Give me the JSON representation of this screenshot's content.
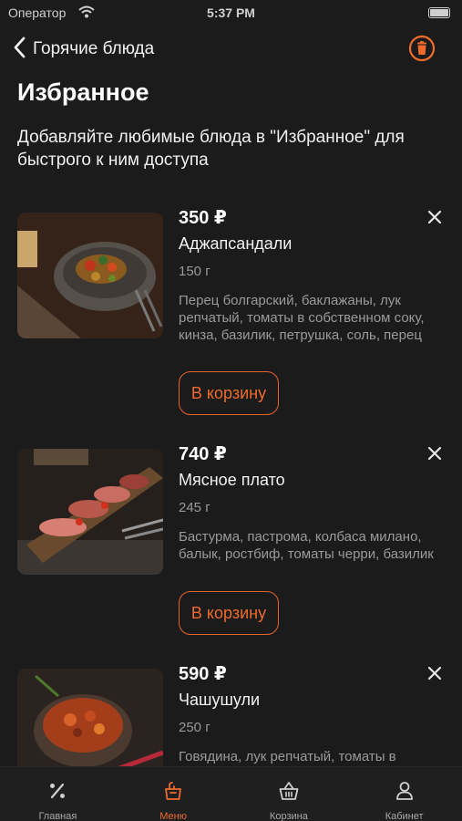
{
  "status_bar": {
    "carrier": "Оператор",
    "time": "5:37 PM"
  },
  "nav": {
    "back_label": "Горячие блюда"
  },
  "page": {
    "title": "Избранное",
    "subtitle": "Добавляйте любимые блюда в \"Избранное\" для быстрого к ним доступа"
  },
  "items": [
    {
      "price": "350 ₽",
      "name": "Аджапсандали",
      "weight": "150 г",
      "ingredients": "Перец болгарский, баклажаны, лук репчатый, томаты в собственном соку, кинза, базилик, петрушка, соль, перец красный, чеснок, масло раст…",
      "button": "В корзину"
    },
    {
      "price": "740 ₽",
      "name": "Мясное плато",
      "weight": "245 г",
      "ingredients": "Бастурма, пастрома, колбаса милано, балык, ростбиф, томаты черри, базилик",
      "button": "В корзину"
    },
    {
      "price": "590 ₽",
      "name": "Чашушули",
      "weight": "250 г",
      "ingredients": "Говядина, лук репчатый, томаты в"
    }
  ],
  "tabs": [
    {
      "label": "Главная",
      "icon": "percent-icon",
      "active": false
    },
    {
      "label": "Меню",
      "icon": "menu-icon",
      "active": true
    },
    {
      "label": "Корзина",
      "icon": "basket-icon",
      "active": false
    },
    {
      "label": "Кабинет",
      "icon": "user-icon",
      "active": false
    }
  ],
  "colors": {
    "accent": "#ef6a2b",
    "background": "#1b1b1b",
    "muted_text": "#9a9a9a"
  }
}
